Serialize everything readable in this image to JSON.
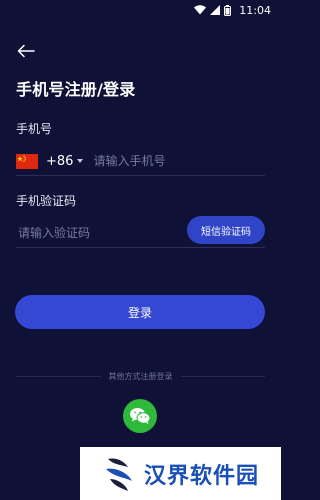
{
  "status_bar": {
    "time": "11:04"
  },
  "header": {
    "title": "手机号注册/登录"
  },
  "form": {
    "phone_label": "手机号",
    "country_code": "+86",
    "phone_placeholder": "请输入手机号",
    "code_label": "手机验证码",
    "code_placeholder": "请输入验证码",
    "sms_button": "短信验证码",
    "login_button": "登录"
  },
  "other_login": {
    "text": "其他方式注册登录"
  },
  "watermark": {
    "text": "汉界软件园"
  },
  "colors": {
    "background": "#0f1236",
    "primary": "#3448d3",
    "wechat": "#2fb83a",
    "divider": "#2a2e5a"
  }
}
